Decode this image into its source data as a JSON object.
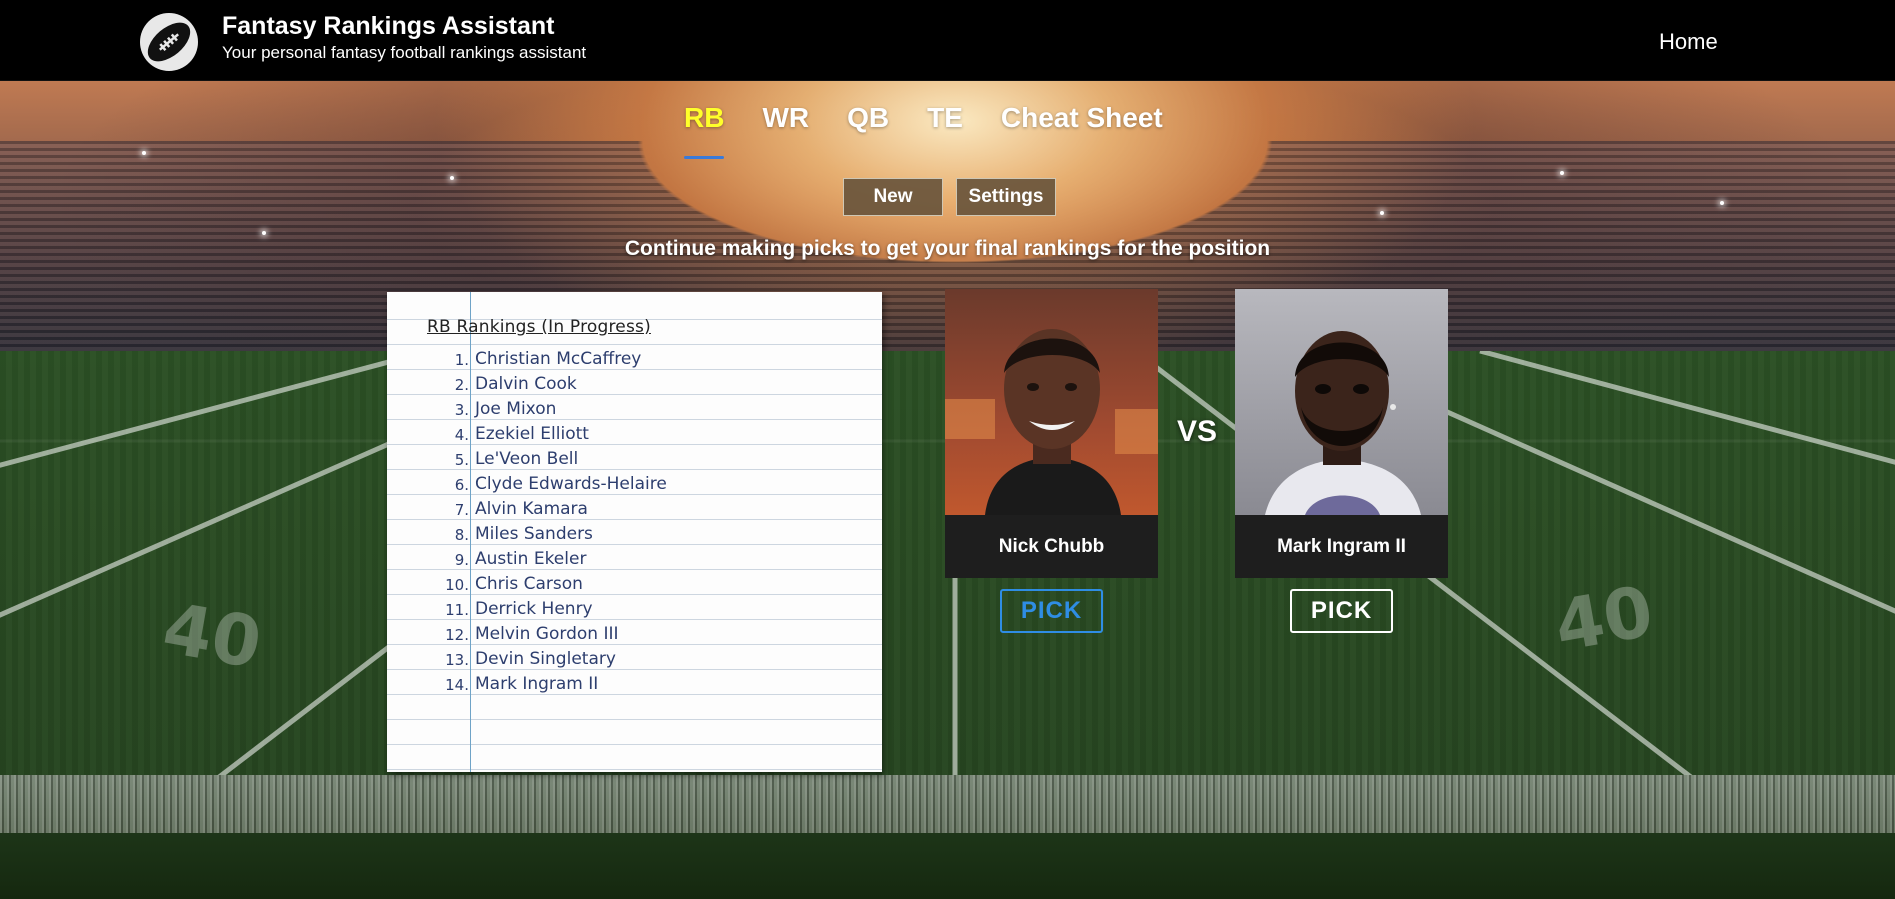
{
  "header": {
    "title": "Fantasy Rankings Assistant",
    "subtitle": "Your personal fantasy football rankings assistant",
    "nav_home": "Home",
    "logo_icon": "football-icon"
  },
  "tabs": [
    {
      "label": "RB",
      "active": true
    },
    {
      "label": "WR",
      "active": false
    },
    {
      "label": "QB",
      "active": false
    },
    {
      "label": "TE",
      "active": false
    },
    {
      "label": "Cheat Sheet",
      "active": false
    }
  ],
  "buttons": {
    "new_label": "New",
    "settings_label": "Settings"
  },
  "instruction": "Continue making picks to get your final rankings for the position",
  "rankings": {
    "title": "RB Rankings (In Progress)",
    "items": [
      {
        "num": "1.",
        "name": "Christian McCaffrey"
      },
      {
        "num": "2.",
        "name": "Dalvin Cook"
      },
      {
        "num": "3.",
        "name": "Joe Mixon"
      },
      {
        "num": "4.",
        "name": "Ezekiel Elliott"
      },
      {
        "num": "5.",
        "name": "Le'Veon Bell"
      },
      {
        "num": "6.",
        "name": "Clyde Edwards-Helaire"
      },
      {
        "num": "7.",
        "name": "Alvin Kamara"
      },
      {
        "num": "8.",
        "name": "Miles Sanders"
      },
      {
        "num": "9.",
        "name": "Austin Ekeler"
      },
      {
        "num": "10.",
        "name": "Chris Carson"
      },
      {
        "num": "11.",
        "name": "Derrick Henry"
      },
      {
        "num": "12.",
        "name": "Melvin Gordon III"
      },
      {
        "num": "13.",
        "name": "Devin Singletary"
      },
      {
        "num": "14.",
        "name": "Mark Ingram II"
      }
    ]
  },
  "matchup": {
    "vs_label": "VS",
    "left": {
      "name": "Nick Chubb",
      "pick_label": "PICK"
    },
    "right": {
      "name": "Mark Ingram II",
      "pick_label": "PICK"
    }
  },
  "colors": {
    "active_tab": "#ffff2a",
    "tab_underline": "#3a7ad9",
    "pick_highlight": "#2f8de4",
    "header_bg": "#000000"
  }
}
